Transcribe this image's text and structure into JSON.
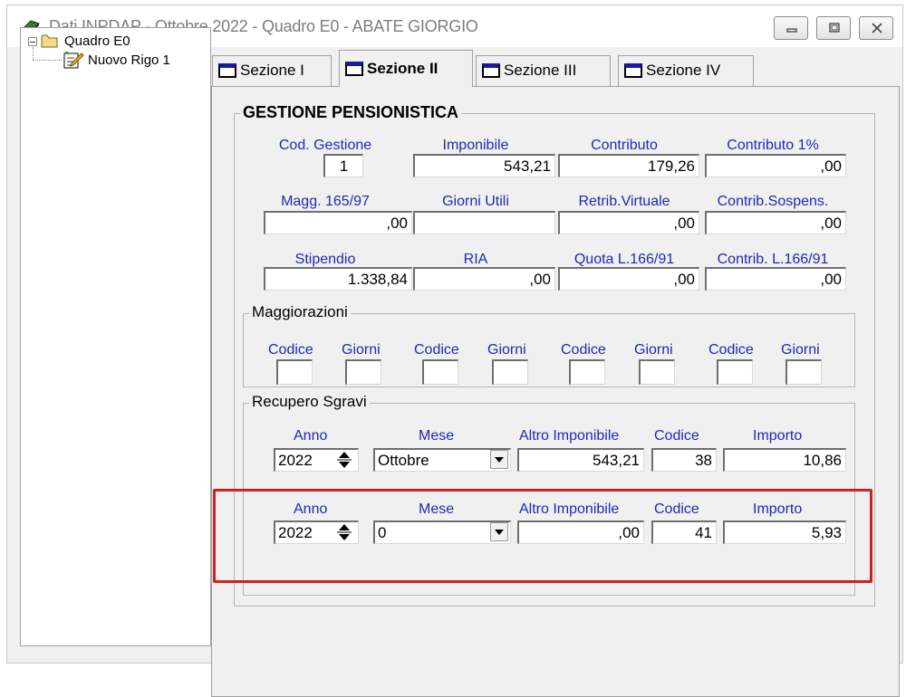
{
  "window": {
    "title": "Dati INPDAP - Ottobre 2022 - Quadro E0 - ABATE GIORGIO",
    "icon": "green-book-icon"
  },
  "tree": {
    "root_label": "Quadro E0",
    "child_label": "Nuovo Rigo 1"
  },
  "tabs": [
    {
      "label": "Sezione I",
      "active": false
    },
    {
      "label": "Sezione II",
      "active": true
    },
    {
      "label": "Sezione III",
      "active": false
    },
    {
      "label": "Sezione IV",
      "active": false
    }
  ],
  "gestione": {
    "title": "GESTIONE PENSIONISTICA",
    "labels": {
      "cod_gestione": "Cod. Gestione",
      "imponibile": "Imponibile",
      "contributo": "Contributo",
      "contributo_1": "Contributo 1%",
      "magg": "Magg. 165/97",
      "giorni_utili": "Giorni Utili",
      "retrib_virtuale": "Retrib.Virtuale",
      "contrib_sospens": "Contrib.Sospens.",
      "stipendio": "Stipendio",
      "ria": "RIA",
      "quota": "Quota L.166/91",
      "contrib_166": "Contrib. L.166/91"
    },
    "values": {
      "cod_gestione": "1",
      "imponibile": "543,21",
      "contributo": "179,26",
      "contributo_1": ",00",
      "magg": ",00",
      "giorni_utili": "",
      "retrib_virtuale": ",00",
      "contrib_sospens": ",00",
      "stipendio": "1.338,84",
      "ria": ",00",
      "quota": ",00",
      "contrib_166": ",00"
    }
  },
  "maggiorazioni": {
    "title": "Maggiorazioni",
    "codice_label": "Codice",
    "giorni_label": "Giorni"
  },
  "recupero": {
    "title": "Recupero Sgravi",
    "labels": {
      "anno": "Anno",
      "mese": "Mese",
      "altro_imponibile": "Altro Imponibile",
      "codice": "Codice",
      "importo": "Importo"
    },
    "rows": [
      {
        "anno": "2022",
        "mese": "Ottobre",
        "altro_imponibile": "543,21",
        "codice": "38",
        "importo": "10,86"
      },
      {
        "anno": "2022",
        "mese": "0",
        "altro_imponibile": ",00",
        "codice": "41",
        "importo": "5,93"
      }
    ]
  },
  "colors": {
    "label_blue": "#1f28b4",
    "highlight_red": "#d01f26"
  }
}
